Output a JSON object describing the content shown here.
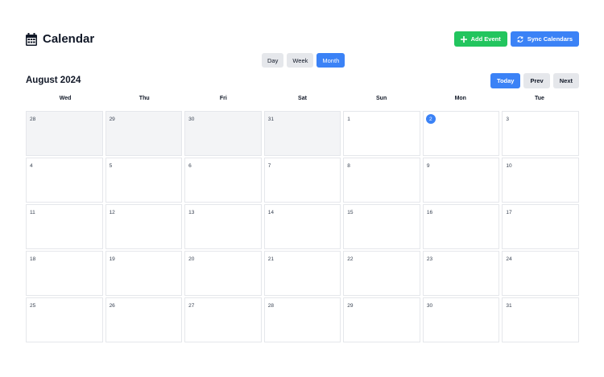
{
  "header": {
    "title": "Calendar",
    "add_event_label": "Add Event",
    "sync_label": "Sync Calendars"
  },
  "views": [
    {
      "label": "Day",
      "active": false
    },
    {
      "label": "Week",
      "active": false
    },
    {
      "label": "Month",
      "active": true
    }
  ],
  "month_label": "August 2024",
  "nav": {
    "today": "Today",
    "prev": "Prev",
    "next": "Next"
  },
  "weekdays": [
    "Wed",
    "Thu",
    "Fri",
    "Sat",
    "Sun",
    "Mon",
    "Tue"
  ],
  "days": [
    {
      "n": "28",
      "muted": true
    },
    {
      "n": "29",
      "muted": true
    },
    {
      "n": "30",
      "muted": true
    },
    {
      "n": "31",
      "muted": true
    },
    {
      "n": "1"
    },
    {
      "n": "2",
      "today": true
    },
    {
      "n": "3"
    },
    {
      "n": "4"
    },
    {
      "n": "5"
    },
    {
      "n": "6"
    },
    {
      "n": "7"
    },
    {
      "n": "8"
    },
    {
      "n": "9"
    },
    {
      "n": "10"
    },
    {
      "n": "11"
    },
    {
      "n": "12"
    },
    {
      "n": "13"
    },
    {
      "n": "14"
    },
    {
      "n": "15"
    },
    {
      "n": "16"
    },
    {
      "n": "17"
    },
    {
      "n": "18"
    },
    {
      "n": "19"
    },
    {
      "n": "20"
    },
    {
      "n": "21"
    },
    {
      "n": "22"
    },
    {
      "n": "23"
    },
    {
      "n": "24"
    },
    {
      "n": "25"
    },
    {
      "n": "26"
    },
    {
      "n": "27"
    },
    {
      "n": "28"
    },
    {
      "n": "29"
    },
    {
      "n": "30"
    },
    {
      "n": "31"
    }
  ],
  "colors": {
    "accent": "#3b82f6",
    "add": "#22c55e",
    "muted_cell": "#f3f4f6"
  },
  "icons": {
    "title": "calendar-icon",
    "add": "plus-icon",
    "sync": "sync-icon"
  }
}
